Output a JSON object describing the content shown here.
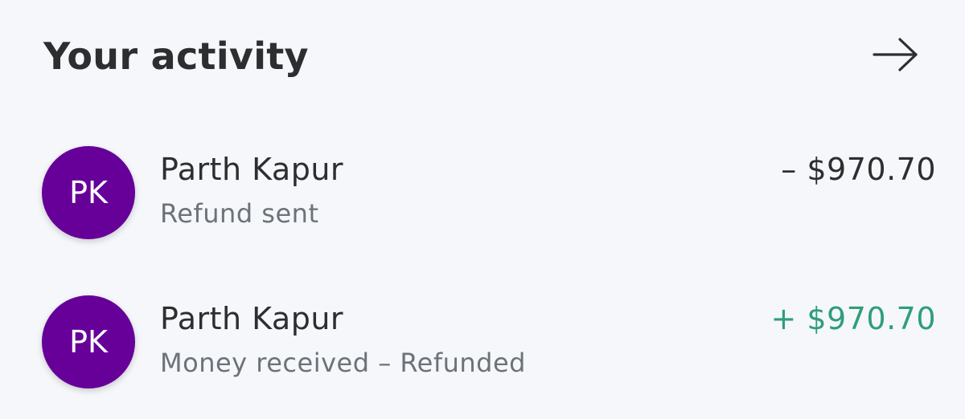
{
  "header": {
    "title": "Your activity",
    "icon": "arrow-right-icon"
  },
  "activity": [
    {
      "initials": "PK",
      "name": "Parth Kapur",
      "status": "Refund sent",
      "amount": "– $970.70",
      "direction": "debit"
    },
    {
      "initials": "PK",
      "name": "Parth Kapur",
      "status": "Money received – Refunded",
      "amount": "+ $970.70",
      "direction": "credit"
    }
  ],
  "colors": {
    "background": "#f5f7fa",
    "avatar": "#660099",
    "credit": "#2e9e79",
    "text": "#2c2e2f",
    "muted": "#6c7378"
  }
}
